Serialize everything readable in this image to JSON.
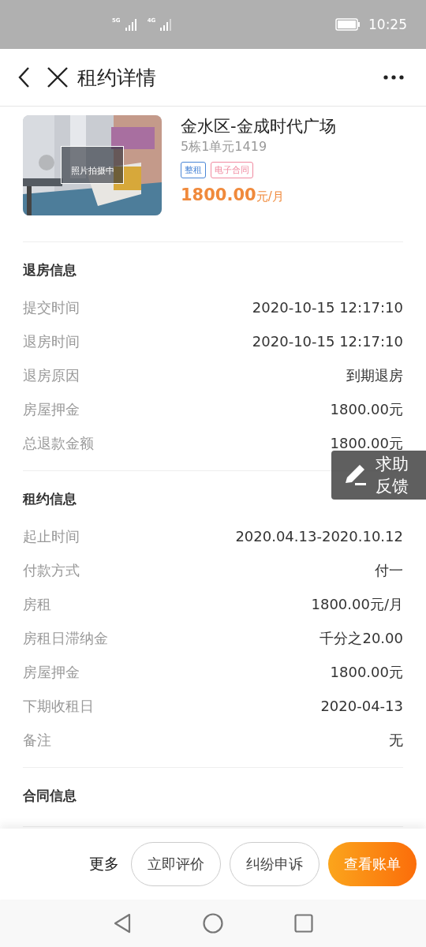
{
  "status_bar": {
    "network_1": "5G",
    "network_2": "4G",
    "time": "10:25"
  },
  "header": {
    "title": "租约详情"
  },
  "listing": {
    "photo": {
      "kind": "picture",
      "caption": "照片拍摄中"
    },
    "name": "金水区-金成时代广场",
    "unit": "5栋1单元1419",
    "tags": [
      {
        "label": "整租",
        "color": "#4a86d6"
      },
      {
        "label": "电子合同",
        "color": "#f08aa0"
      }
    ],
    "price": "1800.00",
    "price_unit": "元/月"
  },
  "sections": [
    {
      "title": "退房信息",
      "rows": [
        {
          "label": "提交时间",
          "value": "2020-10-15 12:17:10"
        },
        {
          "label": "退房时间",
          "value": "2020-10-15 12:17:10"
        },
        {
          "label": "退房原因",
          "value": "到期退房"
        },
        {
          "label": "房屋押金",
          "value": "1800.00元"
        },
        {
          "label": "总退款金额",
          "value": "1800.00元"
        }
      ]
    },
    {
      "title": "租约信息",
      "rows": [
        {
          "label": "起止时间",
          "value": "2020.04.13-2020.10.12"
        },
        {
          "label": "付款方式",
          "value": "付一"
        },
        {
          "label": "房租",
          "value": "1800.00元/月"
        },
        {
          "label": "房租日滞纳金",
          "value": "千分之20.00"
        },
        {
          "label": "房屋押金",
          "value": "1800.00元"
        },
        {
          "label": "下期收租日",
          "value": "2020-04-13"
        },
        {
          "label": "备注",
          "value": "无"
        }
      ]
    },
    {
      "title": "合同信息"
    }
  ],
  "feedback": {
    "line_1": "求助",
    "line_2": "反馈"
  },
  "bottom_bar": {
    "more": "更多",
    "buttons": [
      {
        "label": "立即评价",
        "kind": "outline"
      },
      {
        "label": "纠纷申诉",
        "kind": "outline"
      },
      {
        "label": "查看账单",
        "kind": "primary"
      }
    ]
  }
}
